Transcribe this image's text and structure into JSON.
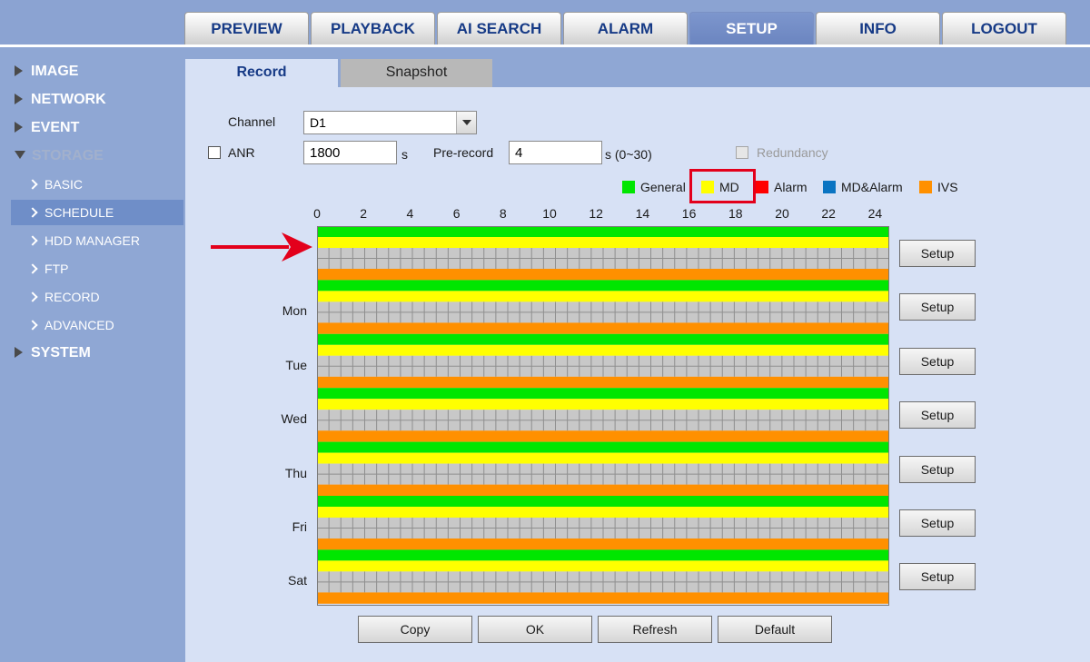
{
  "nav": {
    "tabs": [
      {
        "label": "PREVIEW"
      },
      {
        "label": "PLAYBACK"
      },
      {
        "label": "AI SEARCH"
      },
      {
        "label": "ALARM"
      },
      {
        "label": "SETUP",
        "active": true
      },
      {
        "label": "INFO"
      },
      {
        "label": "LOGOUT"
      }
    ]
  },
  "sidebar": {
    "image": "IMAGE",
    "network": "NETWORK",
    "event": "EVENT",
    "storage": "STORAGE",
    "storage_items": [
      {
        "label": "BASIC"
      },
      {
        "label": "SCHEDULE",
        "active": true
      },
      {
        "label": "HDD MANAGER"
      },
      {
        "label": "FTP"
      },
      {
        "label": "RECORD"
      },
      {
        "label": "ADVANCED"
      }
    ],
    "system": "SYSTEM"
  },
  "subtabs": {
    "record": "Record",
    "snapshot": "Snapshot"
  },
  "form": {
    "channel_label": "Channel",
    "channel_value": "D1",
    "anr_label": "ANR",
    "anr_value": "1800",
    "anr_unit": "s",
    "prerecord_label": "Pre-record",
    "prerecord_value": "4",
    "prerecord_unit": "s (0~30)",
    "redundancy_label": "Redundancy"
  },
  "legend": [
    {
      "label": "General",
      "color": "#00e600"
    },
    {
      "label": "MD",
      "color": "#ffff00"
    },
    {
      "label": "Alarm",
      "color": "#ff0000"
    },
    {
      "label": "MD&Alarm",
      "color": "#0a74c2"
    },
    {
      "label": "IVS",
      "color": "#ff9000"
    }
  ],
  "schedule": {
    "hours": [
      "0",
      "2",
      "4",
      "6",
      "8",
      "10",
      "12",
      "14",
      "16",
      "18",
      "20",
      "22",
      "24"
    ],
    "days": [
      "",
      "Mon",
      "Tue",
      "Wed",
      "Thu",
      "Fri",
      "Sat"
    ],
    "colors": {
      "general": "#00e600",
      "md": "#ffff00",
      "ivs": "#ff9000",
      "cell": "#c8c8c8",
      "cell_line": "#8f8f8f"
    },
    "setup_label": "Setup"
  },
  "buttons": {
    "copy": "Copy",
    "ok": "OK",
    "refresh": "Refresh",
    "default": "Default"
  }
}
